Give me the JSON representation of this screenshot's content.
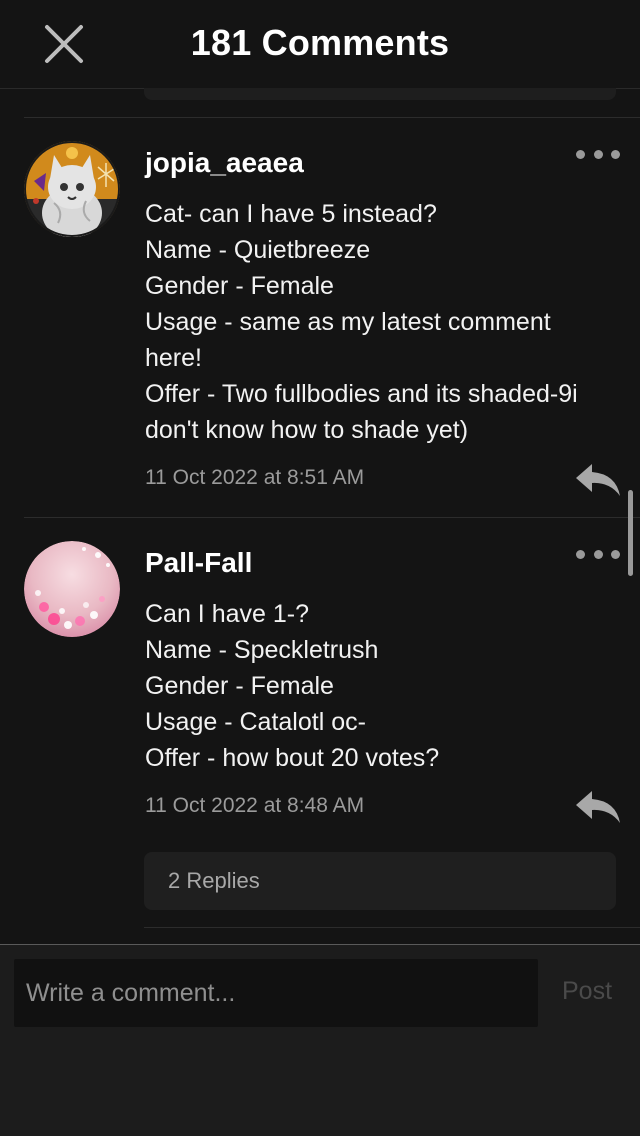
{
  "header": {
    "title": "181 Comments",
    "close_icon": "close-x-icon"
  },
  "comments": [
    {
      "username": "jopia_aeaea",
      "avatar": "cat-avatar",
      "lines": [
        "Cat- can I have 5 instead?",
        "Name - Quietbreeze",
        "Gender - Female",
        "Usage - same as my latest comment",
        "here!",
        "Offer - Two fullbodies and its shaded-9i",
        "don't know how to shade yet)"
      ],
      "timestamp": "11 Oct 2022 at 8:51 AM"
    },
    {
      "username": "Pall-Fall",
      "avatar": "pink-bokeh-avatar",
      "lines": [
        "Can I have 1-?",
        "Name - Speckletrush",
        "Gender - Female",
        "Usage - Catalotl oc-",
        "Offer - how bout 20 votes?"
      ],
      "timestamp": "11 Oct 2022 at 8:48 AM",
      "replies_label": "2 Replies"
    }
  ],
  "composer": {
    "placeholder": "Write a comment...",
    "post_label": "Post"
  },
  "colors": {
    "background": "#141414",
    "text": "#ffffff",
    "muted": "#9b9b9b",
    "post_disabled": "#4a4a4a"
  }
}
